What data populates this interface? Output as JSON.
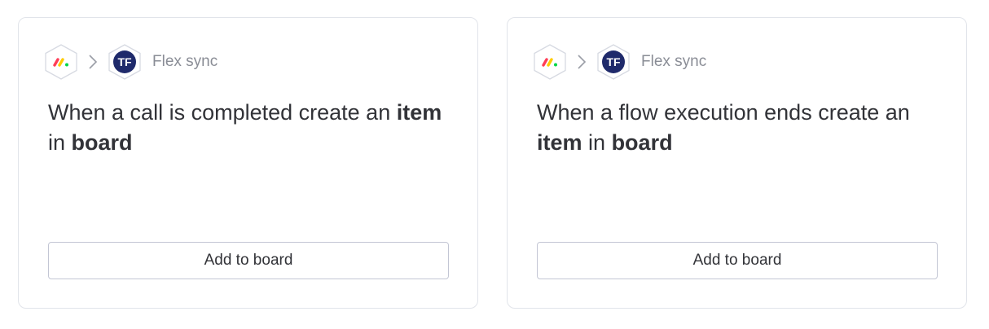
{
  "cards": [
    {
      "source_icon": "monday-logo-icon",
      "separator_icon": "chevron-right-icon",
      "target_icon_text": "TF",
      "app_name": "Flex sync",
      "title_parts": [
        "When a call is completed create an ",
        "item",
        " in ",
        "board"
      ],
      "button_label": "Add to board"
    },
    {
      "source_icon": "monday-logo-icon",
      "separator_icon": "chevron-right-icon",
      "target_icon_text": "TF",
      "app_name": "Flex sync",
      "title_parts": [
        "When a flow execution ends create an ",
        "item",
        " in ",
        "board"
      ],
      "button_label": "Add to board"
    }
  ],
  "colors": {
    "tf_badge": "#1f2a6b",
    "monday_red": "#ff3d57",
    "monday_yellow": "#ffcb00",
    "monday_green": "#00d647",
    "text": "#323338",
    "muted": "#8a8d96",
    "border": "#e1e4ea"
  }
}
